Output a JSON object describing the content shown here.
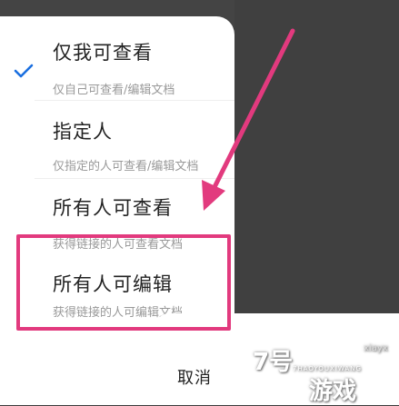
{
  "options": [
    {
      "title": "仅我可查看",
      "desc": "仅自己可查看/编辑文档",
      "selected": true
    },
    {
      "title": "指定人",
      "desc": "仅指定的人可查看/编辑文档",
      "selected": false
    },
    {
      "title": "所有人可查看",
      "desc": "获得链接的人可查看文档",
      "selected": false
    },
    {
      "title": "所有人可编辑",
      "desc": "获得链接的人可编辑文档",
      "selected": false
    }
  ],
  "cancel_label": "取消",
  "watermark": {
    "main": "7号",
    "sub": "7HAOYOUXIWANG",
    "game": "游戏",
    "url": "xiayx"
  },
  "colors": {
    "check": "#1a6fe0",
    "highlight": "#e23a7e",
    "arrow": "#e23a7e"
  }
}
